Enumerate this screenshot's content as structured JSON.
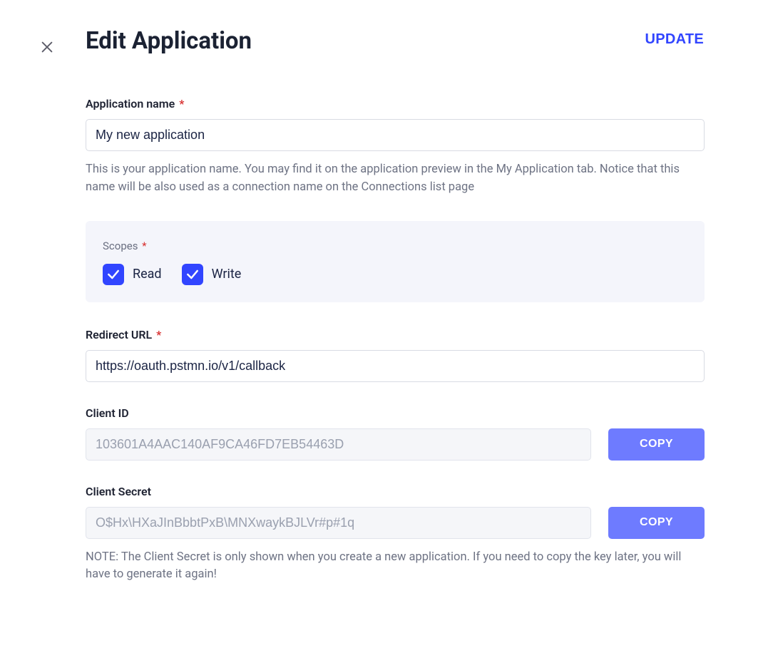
{
  "header": {
    "title": "Edit Application",
    "update_label": "UPDATE"
  },
  "appname": {
    "label": "Application name",
    "value": "My new application",
    "helper": "This is your application name. You may find it on the application preview in the My Application tab. Notice that this name will be also used as a connection name on the Connections list page"
  },
  "scopes": {
    "label": "Scopes",
    "read": {
      "label": "Read",
      "checked": true
    },
    "write": {
      "label": "Write",
      "checked": true
    }
  },
  "redirect": {
    "label": "Redirect URL",
    "value": "https://oauth.pstmn.io/v1/callback"
  },
  "client_id": {
    "label": "Client ID",
    "value": "103601A4AAC140AF9CA46FD7EB54463D",
    "copy_label": "COPY"
  },
  "client_secret": {
    "label": "Client Secret",
    "value": "O$Hx\\HXaJInBbbtPxB\\MNXwaykBJLVr#p#1q",
    "copy_label": "COPY",
    "note": "NOTE: The Client Secret is only shown when you create a new application. If you need to copy the key later, you will have to generate it again!"
  }
}
